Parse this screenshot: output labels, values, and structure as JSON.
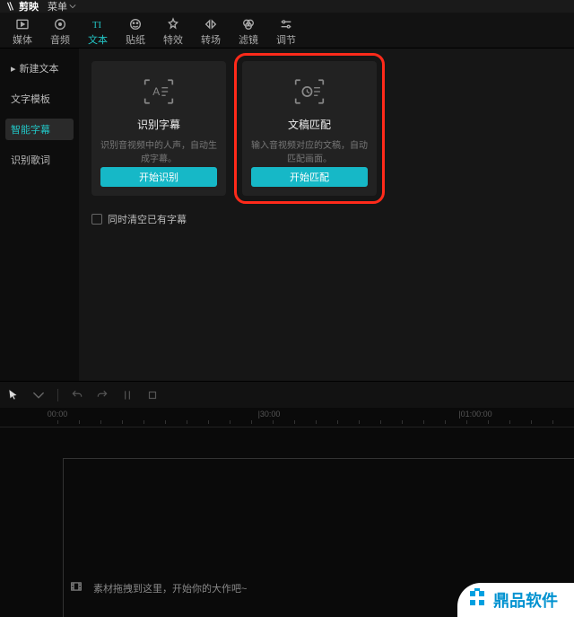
{
  "titlebar": {
    "app_name": "剪映",
    "menu_label": "菜单"
  },
  "toolbar": {
    "items": [
      {
        "label": "媒体"
      },
      {
        "label": "音频"
      },
      {
        "label": "文本"
      },
      {
        "label": "贴纸"
      },
      {
        "label": "特效"
      },
      {
        "label": "转场"
      },
      {
        "label": "滤镜"
      },
      {
        "label": "调节"
      }
    ]
  },
  "sidebar": {
    "items": [
      {
        "label": "新建文本"
      },
      {
        "label": "文字模板"
      },
      {
        "label": "智能字幕"
      },
      {
        "label": "识别歌词"
      }
    ]
  },
  "cards": {
    "recognize": {
      "title": "识别字幕",
      "desc": "识别音视频中的人声，自动生成字幕。",
      "button": "开始识别"
    },
    "match": {
      "title": "文稿匹配",
      "desc": "输入音视频对应的文稿，自动匹配画面。",
      "button": "开始匹配"
    }
  },
  "checkbox": {
    "label": "同时清空已有字幕"
  },
  "timeline": {
    "ticks": [
      "00:00",
      "|30:00",
      "|01:00:00"
    ],
    "placeholder": "素材拖拽到这里，开始你的大作吧~"
  },
  "watermark": {
    "text": "鼎品软件"
  }
}
